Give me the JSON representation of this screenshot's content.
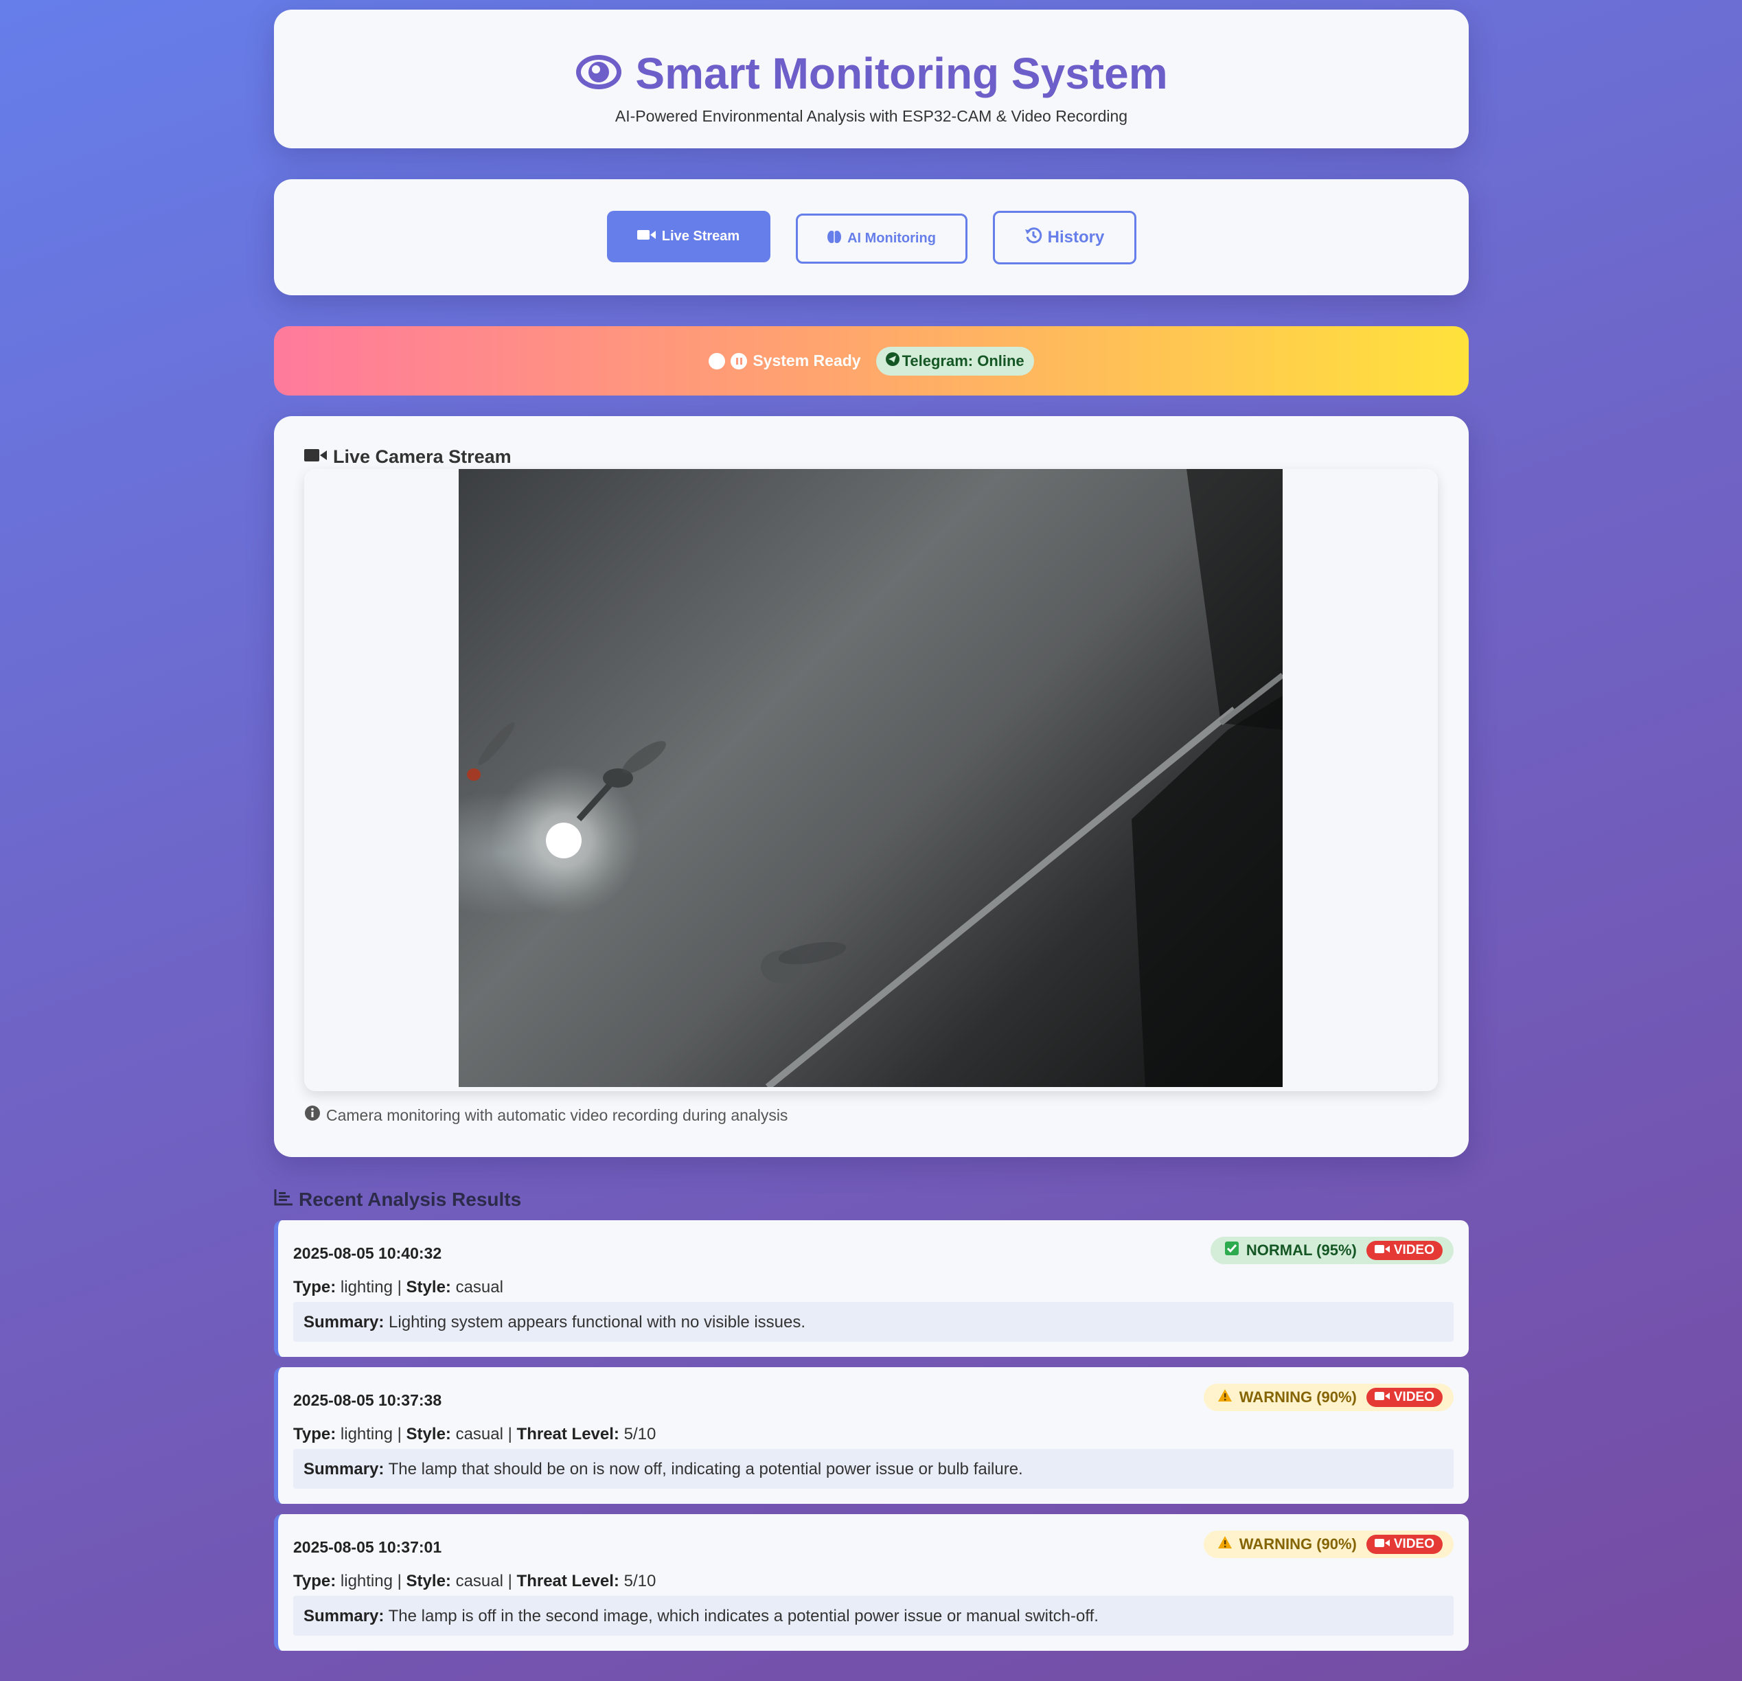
{
  "header": {
    "title": "Smart Monitoring System",
    "subtitle": "AI-Powered Environmental Analysis with ESP32-CAM & Video Recording",
    "icon": "eye-icon"
  },
  "nav": {
    "tabs": [
      {
        "label": "Live Stream",
        "icon": "video-camera-icon",
        "active": true
      },
      {
        "label": "AI Monitoring",
        "icon": "brain-icon",
        "active": false
      },
      {
        "label": "History",
        "icon": "history-icon",
        "active": false
      }
    ]
  },
  "status": {
    "system_text": "System Ready",
    "telegram_text": "Telegram: Online",
    "colors": {
      "gradient_start": "#ff7a9c",
      "gradient_end": "#ffe23b"
    }
  },
  "stream": {
    "title": "Live Camera Stream",
    "caption": "Camera monitoring with automatic video recording during analysis"
  },
  "results": {
    "title": "Recent Analysis Results",
    "labels": {
      "type": "Type:",
      "style": "Style:",
      "threat": "Threat Level:",
      "summary": "Summary:",
      "video": "VIDEO"
    },
    "items": [
      {
        "timestamp": "2025-08-05 10:40:32",
        "status": "NORMAL (95%)",
        "type": "lighting",
        "style": "casual",
        "summary": "Lighting system appears functional with no visible issues."
      },
      {
        "timestamp": "2025-08-05 10:37:38",
        "status": "WARNING (90%)",
        "type": "lighting",
        "style": "casual",
        "threat_level": "5/10",
        "summary": "The lamp that should be on is now off, indicating a potential power issue or bulb failure."
      },
      {
        "timestamp": "2025-08-05 10:37:01",
        "status": "WARNING (90%)",
        "type": "lighting",
        "style": "casual",
        "threat_level": "5/10",
        "summary": "The lamp is off in the second image, which indicates a potential power issue or manual switch-off."
      }
    ]
  },
  "colors": {
    "accent": "#667eea",
    "normal": "#155724",
    "warning": "#856404",
    "video": "#e53935"
  }
}
